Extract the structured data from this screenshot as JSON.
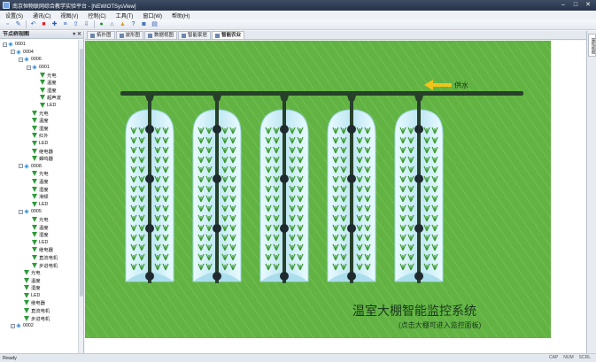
{
  "window": {
    "title": "南京恒物联网综合教学实验平台 - [NEWIOTSysView]",
    "minimize": "–",
    "maximize": "□",
    "close": "✕"
  },
  "menu": [
    "设置(S)",
    "通讯(C)",
    "视图(V)",
    "控制(C)",
    "工具(T)",
    "窗口(W)",
    "帮助(H)"
  ],
  "toolbar_icons": [
    "new-icon",
    "edit-icon",
    "undo-icon",
    "stop-icon",
    "plus-icon",
    "list-icon",
    "upload-icon",
    "download-icon",
    "settings-icon",
    "home-icon",
    "alert-icon",
    "help-icon",
    "camera-icon",
    "chart-icon"
  ],
  "side_panel": {
    "title": "节点树视图",
    "tools": "▾ ✕"
  },
  "tree": [
    {
      "label": "0001",
      "level": 0,
      "type": "net",
      "toggle": "−"
    },
    {
      "label": "0004",
      "level": 1,
      "type": "net",
      "toggle": "−"
    },
    {
      "label": "0006",
      "level": 2,
      "type": "net",
      "toggle": "−"
    },
    {
      "label": "0001",
      "level": 3,
      "type": "net",
      "toggle": "−"
    },
    {
      "label": "光电",
      "level": 4,
      "type": "sensor"
    },
    {
      "label": "温度",
      "level": 4,
      "type": "sensor"
    },
    {
      "label": "湿度",
      "level": 4,
      "type": "sensor"
    },
    {
      "label": "超声波",
      "level": 4,
      "type": "sensor"
    },
    {
      "label": "LED",
      "level": 4,
      "type": "sensor"
    },
    {
      "label": "光电",
      "level": 3,
      "type": "sensor"
    },
    {
      "label": "温度",
      "level": 3,
      "type": "sensor"
    },
    {
      "label": "湿度",
      "level": 3,
      "type": "sensor"
    },
    {
      "label": "红外",
      "level": 3,
      "type": "sensor"
    },
    {
      "label": "LED",
      "level": 3,
      "type": "sensor"
    },
    {
      "label": "继电器",
      "level": 3,
      "type": "sensor"
    },
    {
      "label": "蜂鸣器",
      "level": 3,
      "type": "sensor"
    },
    {
      "label": "0008",
      "level": 2,
      "type": "net",
      "toggle": "−"
    },
    {
      "label": "光电",
      "level": 3,
      "type": "sensor"
    },
    {
      "label": "温度",
      "level": 3,
      "type": "sensor"
    },
    {
      "label": "湿度",
      "level": 3,
      "type": "sensor"
    },
    {
      "label": "滑顿",
      "level": 3,
      "type": "sensor"
    },
    {
      "label": "LED",
      "level": 3,
      "type": "sensor"
    },
    {
      "label": "0005",
      "level": 2,
      "type": "net",
      "toggle": "−"
    },
    {
      "label": "光电",
      "level": 3,
      "type": "sensor"
    },
    {
      "label": "温度",
      "level": 3,
      "type": "sensor"
    },
    {
      "label": "湿度",
      "level": 3,
      "type": "sensor"
    },
    {
      "label": "LED",
      "level": 3,
      "type": "sensor"
    },
    {
      "label": "继电器",
      "level": 3,
      "type": "sensor"
    },
    {
      "label": "直流电机",
      "level": 3,
      "type": "sensor"
    },
    {
      "label": "步进电机",
      "level": 3,
      "type": "sensor"
    },
    {
      "label": "光电",
      "level": 2,
      "type": "sensor"
    },
    {
      "label": "温度",
      "level": 2,
      "type": "sensor"
    },
    {
      "label": "湿度",
      "level": 2,
      "type": "sensor"
    },
    {
      "label": "LED",
      "level": 2,
      "type": "sensor"
    },
    {
      "label": "继电器",
      "level": 2,
      "type": "sensor"
    },
    {
      "label": "直流电机",
      "level": 2,
      "type": "sensor"
    },
    {
      "label": "步进电机",
      "level": 2,
      "type": "sensor"
    },
    {
      "label": "0002",
      "level": 1,
      "type": "net",
      "toggle": "+"
    }
  ],
  "tabs": [
    {
      "label": "拓扑图",
      "active": false
    },
    {
      "label": "波形图",
      "active": false
    },
    {
      "label": "数据视图",
      "active": false
    },
    {
      "label": "智能家居",
      "active": false
    },
    {
      "label": "智能农业",
      "active": true
    }
  ],
  "greenhouse": {
    "supply_label": "供水",
    "title": "温室大棚智能监控系统",
    "hint": "(点击大棚可进入监控面板)",
    "house_count": 5,
    "colors": {
      "field": "#62b344",
      "pipe": "#27402a",
      "dome": "#cfeef6",
      "arrow": "#f2c418",
      "plant": "#3c9a2e"
    }
  },
  "right_dock": {
    "label": "属性视图"
  },
  "status": {
    "left": "Ready",
    "caps": "CAP",
    "num": "NUM",
    "scrl": "SCRL"
  }
}
